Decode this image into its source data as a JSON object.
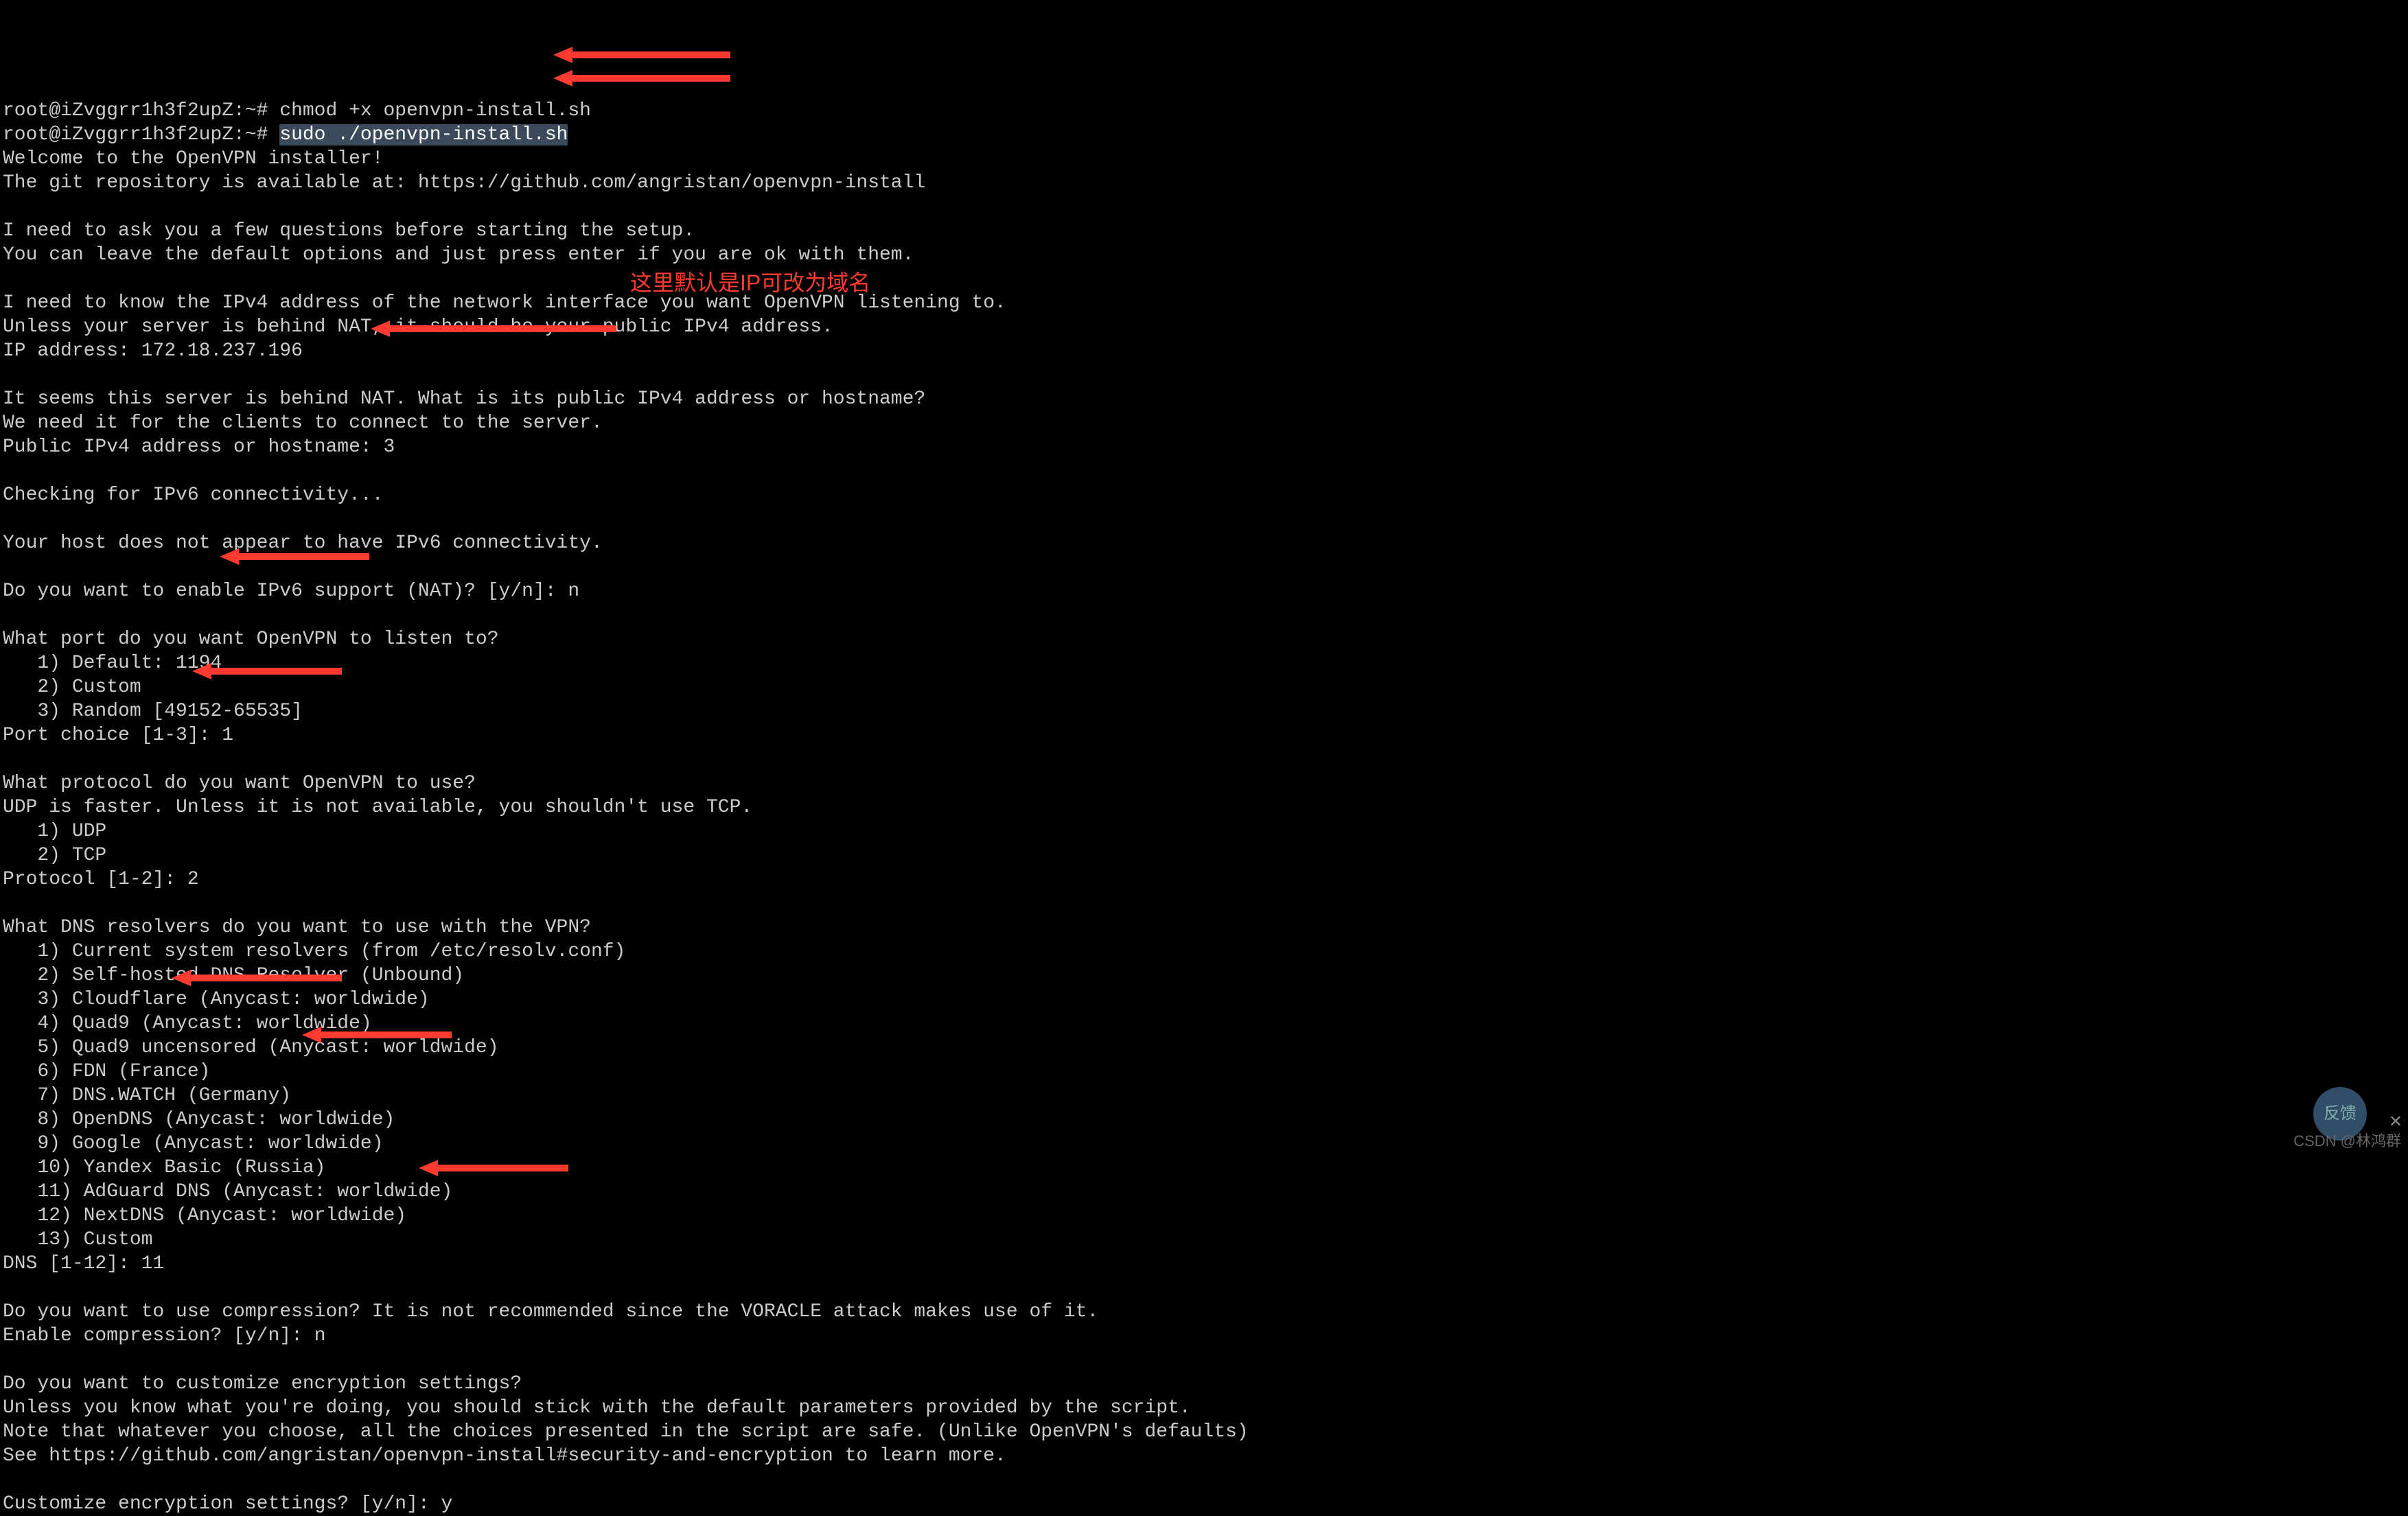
{
  "term": {
    "prompt1_prefix": "root@iZvggrr1h3f2upZ:~# ",
    "cmd1": "chmod +x openvpn-install.sh",
    "prompt2_prefix": "root@iZvggrr1h3f2upZ:~# ",
    "cmd2_hl": "sudo ./openvpn-install.sh",
    "welcome": "Welcome to the OpenVPN installer!",
    "repo": "The git repository is available at: https://github.com/angristan/openvpn-install",
    "q_intro1": "I need to ask you a few questions before starting the setup.",
    "q_intro2": "You can leave the default options and just press enter if you are ok with them.",
    "ipv4_q1": "I need to know the IPv4 address of the network interface you want OpenVPN listening to.",
    "ipv4_q2": "Unless your server is behind NAT, it should be your public IPv4 address.",
    "ipv4_val": "IP address: 172.18.237.196",
    "nat1": "It seems this server is behind NAT. What is its public IPv4 address or hostname?",
    "nat2": "We need it for the clients to connect to the server.",
    "nat3": "Public IPv4 address or hostname: 3",
    "ipv6_check": "Checking for IPv6 connectivity...",
    "ipv6_nohost": "Your host does not appear to have IPv6 connectivity.",
    "ipv6_enable": "Do you want to enable IPv6 support (NAT)? [y/n]: n",
    "port_q": "What port do you want OpenVPN to listen to?",
    "port_1": "   1) Default: 1194",
    "port_2": "   2) Custom",
    "port_3": "   3) Random [49152-65535]",
    "port_choice": "Port choice [1-3]: 1",
    "proto_q": "What protocol do you want OpenVPN to use?",
    "proto_note": "UDP is faster. Unless it is not available, you shouldn't use TCP.",
    "proto_1": "   1) UDP",
    "proto_2": "   2) TCP",
    "proto_choice": "Protocol [1-2]: 2",
    "dns_q": "What DNS resolvers do you want to use with the VPN?",
    "dns_1": "   1) Current system resolvers (from /etc/resolv.conf)",
    "dns_2": "   2) Self-hosted DNS Resolver (Unbound)",
    "dns_3": "   3) Cloudflare (Anycast: worldwide)",
    "dns_4": "   4) Quad9 (Anycast: worldwide)",
    "dns_5": "   5) Quad9 uncensored (Anycast: worldwide)",
    "dns_6": "   6) FDN (France)",
    "dns_7": "   7) DNS.WATCH (Germany)",
    "dns_8": "   8) OpenDNS (Anycast: worldwide)",
    "dns_9": "   9) Google (Anycast: worldwide)",
    "dns_10": "   10) Yandex Basic (Russia)",
    "dns_11": "   11) AdGuard DNS (Anycast: worldwide)",
    "dns_12": "   12) NextDNS (Anycast: worldwide)",
    "dns_13": "   13) Custom",
    "dns_choice": "DNS [1-12]: 11",
    "comp_q": "Do you want to use compression? It is not recommended since the VORACLE attack makes use of it.",
    "comp_choice": "Enable compression? [y/n]: n",
    "enc_q": "Do you want to customize encryption settings?",
    "enc_note1": "Unless you know what you're doing, you should stick with the default parameters provided by the script.",
    "enc_note2": "Note that whatever you choose, all the choices presented in the script are safe. (Unlike OpenVPN's defaults)",
    "enc_note3": "See https://github.com/angristan/openvpn-install#security-and-encryption to learn more.",
    "enc_choice": "Customize encryption settings? [y/n]: y"
  },
  "annotations": {
    "hostname_note": "这里默认是IP可改为域名"
  },
  "footer": {
    "watermark": "CSDN @林鸿群",
    "badge": "反馈"
  }
}
